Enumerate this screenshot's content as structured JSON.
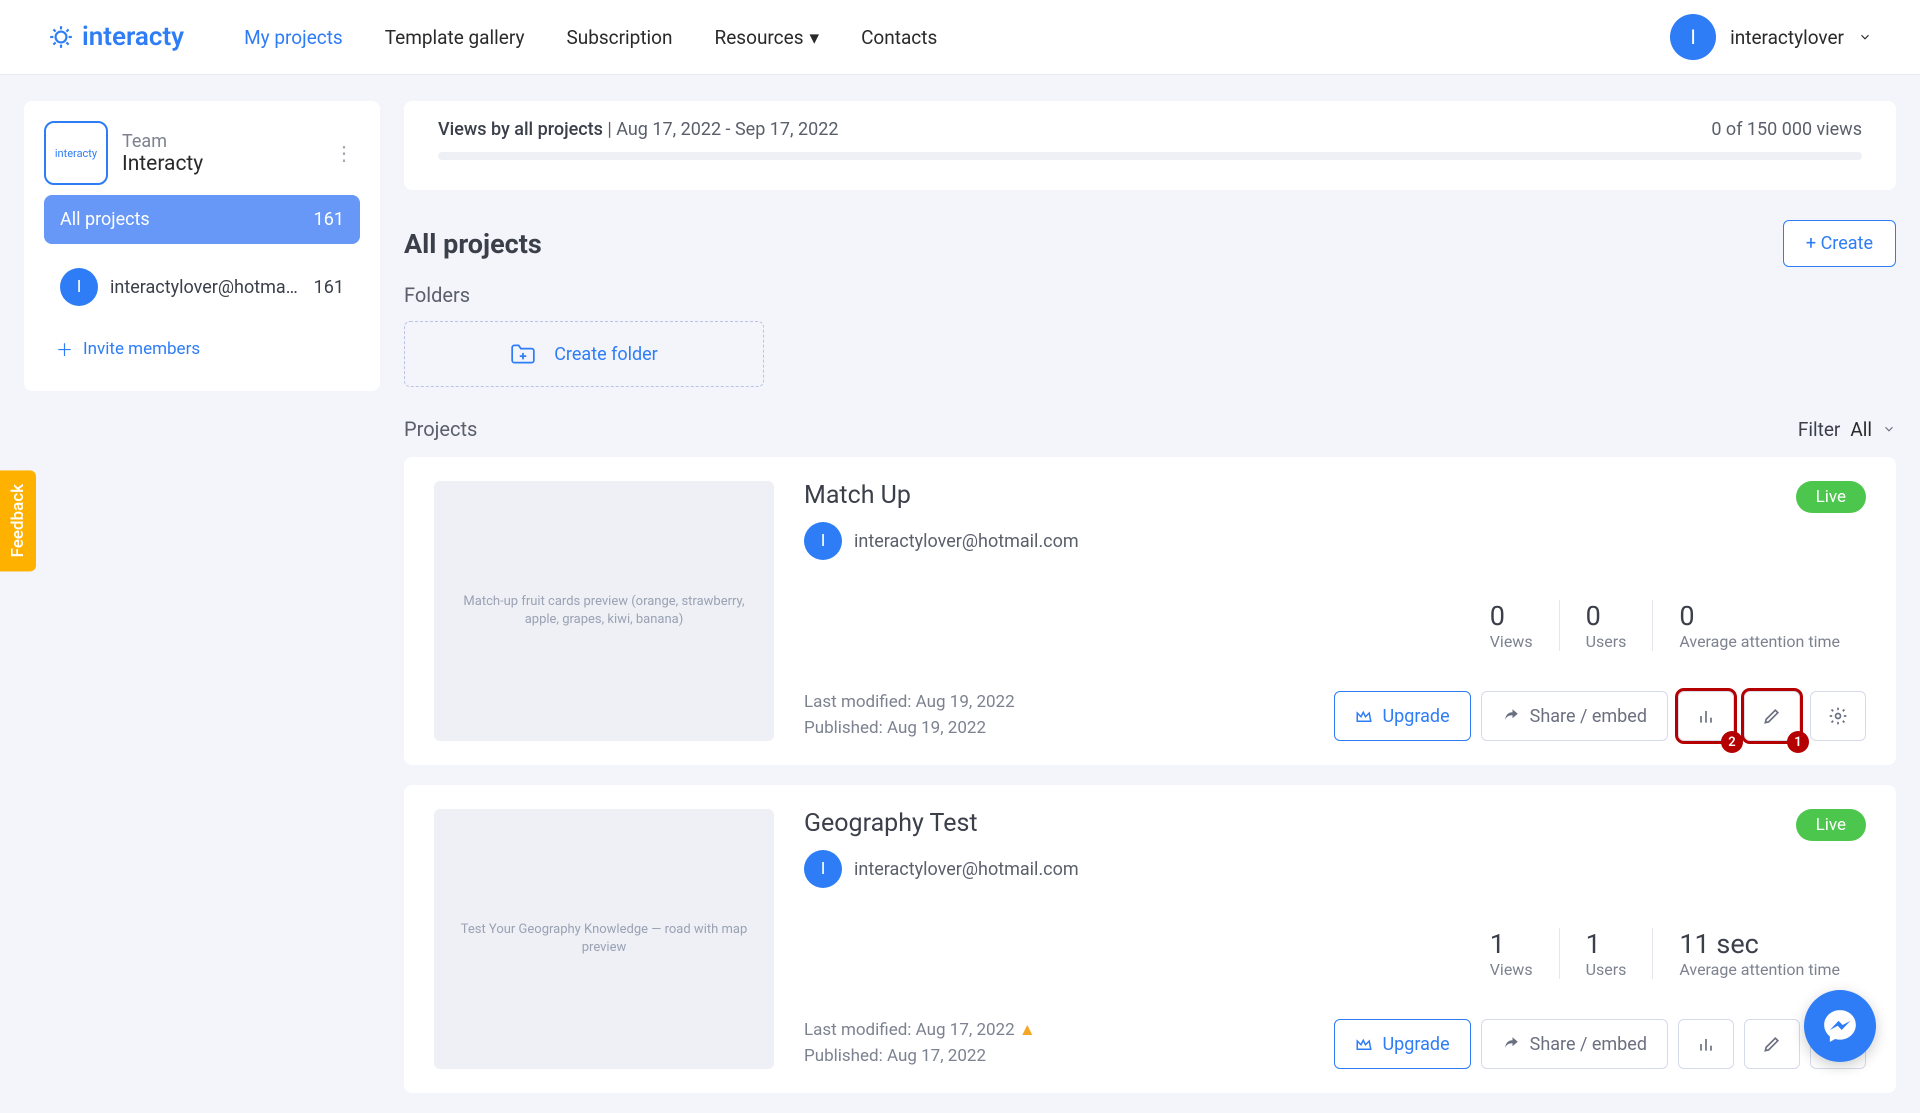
{
  "header": {
    "brand": "interacty",
    "nav": {
      "my_projects": "My projects",
      "template_gallery": "Template gallery",
      "subscription": "Subscription",
      "resources": "Resources",
      "contacts": "Contacts"
    },
    "user": {
      "initial": "I",
      "name": "interactylover"
    }
  },
  "sidebar": {
    "team_label": "Team",
    "team_name": "Interacty",
    "all_projects": {
      "label": "All projects",
      "count": "161"
    },
    "member": {
      "initial": "I",
      "email": "interactylover@hotmail.co…",
      "count": "161"
    },
    "invite": "Invite members"
  },
  "views_panel": {
    "label": "Views by all projects",
    "range": "Aug 17, 2022 - Sep 17, 2022",
    "right": "0 of 150 000 views"
  },
  "page": {
    "title": "All projects",
    "create": "+ Create",
    "folders_label": "Folders",
    "create_folder": "Create folder",
    "projects_label": "Projects",
    "filter_label": "Filter",
    "filter_value": "All"
  },
  "buttons": {
    "upgrade": "Upgrade",
    "share": "Share / embed"
  },
  "status": {
    "live": "Live"
  },
  "stats_labels": {
    "views": "Views",
    "users": "Users",
    "attention": "Average attention time"
  },
  "projects": [
    {
      "title": "Match Up",
      "owner_initial": "I",
      "owner": "interactylover@hotmail.com",
      "views": "0",
      "users": "0",
      "attention": "0",
      "modified": "Last modified: Aug 19, 2022",
      "published": "Published: Aug 19, 2022",
      "thumb_hint": "Match-up fruit cards preview (orange, strawberry, apple, grapes, kiwi, banana)",
      "callout_analytics": "2",
      "callout_edit": "1"
    },
    {
      "title": "Geography Test",
      "owner_initial": "I",
      "owner": "interactylover@hotmail.com",
      "views": "1",
      "users": "1",
      "attention": "11 sec",
      "modified": "Last modified: Aug 17, 2022",
      "published": "Published: Aug 17, 2022",
      "thumb_hint": "Test Your Geography Knowledge — road with map preview"
    }
  ],
  "feedback": "Feedback"
}
